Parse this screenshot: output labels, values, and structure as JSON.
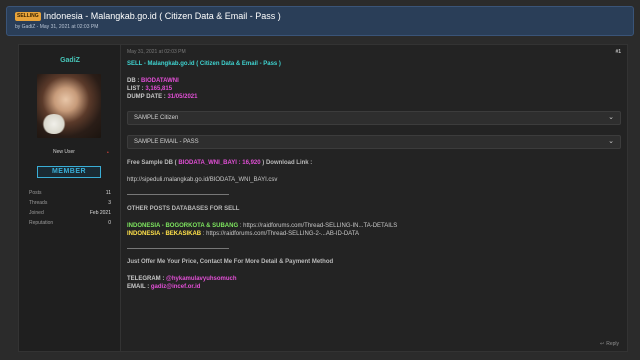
{
  "thread": {
    "prefix": "SELLING",
    "title": "Indonesia - Malangkab.go.id ( Citizen Data & Email - Pass )",
    "byline": "by GadiZ - May 31, 2021 at 02:03 PM"
  },
  "user": {
    "name": "GadiZ",
    "title": "New User",
    "status_icon": "•",
    "rank": "MEMBER",
    "stats": [
      {
        "label": "Posts",
        "value": "11"
      },
      {
        "label": "Threads",
        "value": "3"
      },
      {
        "label": "Joined",
        "value": "Feb 2021"
      },
      {
        "label": "Reputation",
        "value": "0"
      }
    ]
  },
  "post": {
    "meta": "May 31, 2021 at 02:03 PM",
    "number": "#1",
    "headline": "SELL - Malangkab.go.id ( Citizen Data & Email - Pass )",
    "db_label": "DB : ",
    "db_value": "BIODATAWNI",
    "list_label": "LIST : ",
    "list_value": "3,165,815",
    "dump_label": "DUMP DATE : ",
    "dump_value": "31/05/2021",
    "spoiler1": "SAMPLE Citizen",
    "spoiler2": "SAMPLE EMAIL - PASS",
    "free_pre": "Free Sample DB ( ",
    "free_value": "BIODATA_WNI_BAYI : 16,920",
    "free_post": " ) Download Link :",
    "link": "http://sipeduli.malangkab.go.id/BIODATA_WNI_BAYI.csv",
    "other_heading": "OTHER POSTS DATABASES FOR SELL",
    "other1_label": "INDONESIA - BOGORKOTA & SUBANG",
    "other1_url": " : https://raidforums.com/Thread-SELLING-IN...TA-DETAILS",
    "other2_label": "INDONESIA - BEKASIKAB",
    "other2_url": " : https://raidforums.com/Thread-SELLING-2-...AB-ID-DATA",
    "offer": "Just Offer Me Your Price, Contact Me For More Detail & Payment Method",
    "telegram_label": "TELEGRAM : ",
    "telegram_value": "@hykamulavyuhsomuch",
    "email_label": "EMAIL : ",
    "email_value": "gadiz@incef.or.id",
    "reply_label": "Reply"
  }
}
